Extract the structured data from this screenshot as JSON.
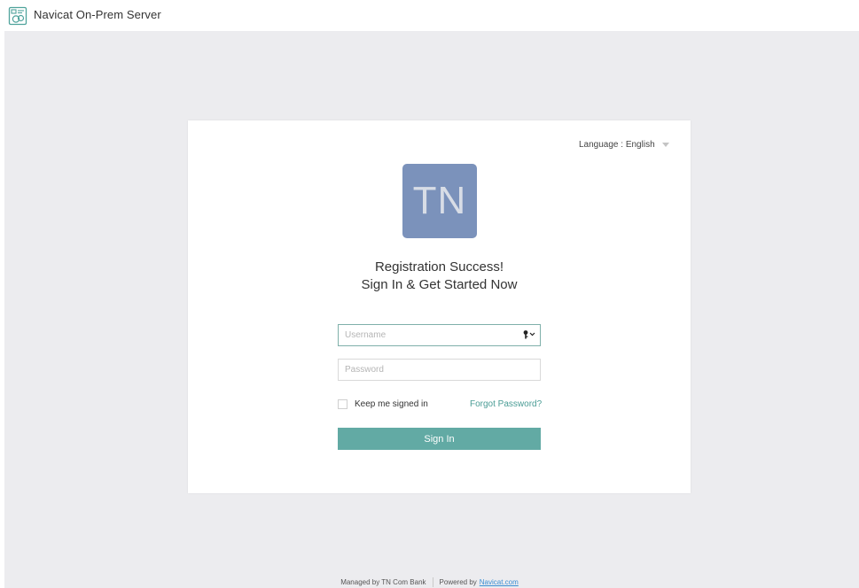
{
  "header": {
    "app_title": "Navicat On-Prem Server",
    "logo_icon": "navicat-logo-icon"
  },
  "card": {
    "language_label": "Language : English",
    "avatar_initials": "TN",
    "heading_line1": "Registration Success!",
    "heading_line2": "Sign In & Get Started Now"
  },
  "form": {
    "username_placeholder": "Username",
    "username_value": "",
    "username_icon": "key-dropdown-icon",
    "password_placeholder": "Password",
    "password_value": "",
    "remember_label": "Keep me signed in",
    "remember_checked": false,
    "forgot_label": "Forgot Password?",
    "signin_label": "Sign In"
  },
  "footer": {
    "managed_text": "Managed by TN Com Bank",
    "powered_text": "Powered by",
    "powered_link": "Navicat.com"
  },
  "colors": {
    "accent": "#62aaa4",
    "link": "#4a9c95",
    "avatar_bg": "#7b92bb",
    "canvas_bg": "#ececef"
  }
}
